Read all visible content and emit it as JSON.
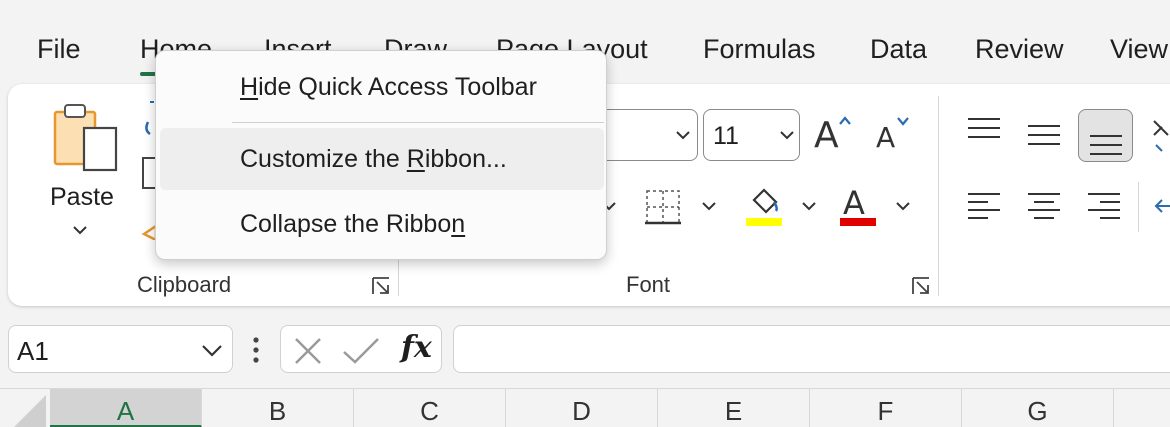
{
  "tabs": [
    "File",
    "Home",
    "Insert",
    "Draw",
    "Page Layout",
    "Formulas",
    "Data",
    "Review",
    "View"
  ],
  "ribbon": {
    "clipboard": {
      "paste_label": "Paste",
      "group_label": "Clipboard"
    },
    "font": {
      "font_size": "11",
      "group_label": "Font",
      "highlight_color": "#ffff00",
      "font_color": "#e00000"
    }
  },
  "context_menu": {
    "items": [
      {
        "pre": "",
        "key": "H",
        "post": "ide Quick Access Toolbar"
      },
      {
        "pre": "Customize the ",
        "key": "R",
        "post": "ibbon..."
      },
      {
        "pre": "Collapse the Ribbo",
        "key": "n",
        "post": ""
      }
    ]
  },
  "formula_bar": {
    "name_box": "A1",
    "fx": "fx",
    "formula": ""
  },
  "columns": [
    "A",
    "B",
    "C",
    "D",
    "E",
    "F",
    "G"
  ],
  "colors": {
    "accent": "#217346"
  }
}
